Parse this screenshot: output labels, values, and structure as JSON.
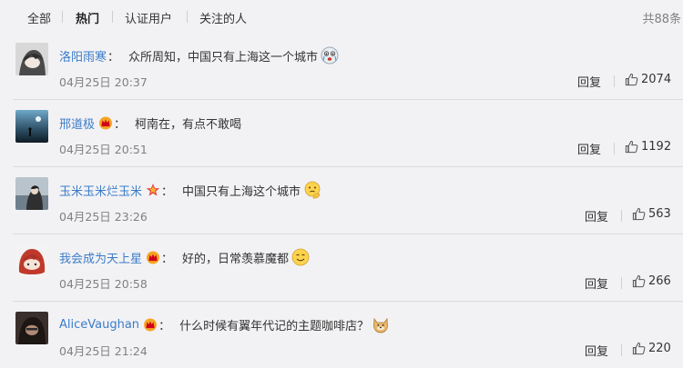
{
  "filter": {
    "tabs": [
      {
        "label": "全部"
      },
      {
        "label": "热门"
      },
      {
        "label": "认证用户"
      },
      {
        "label": "关注的人"
      }
    ],
    "total": "共88条"
  },
  "comments": [
    {
      "user": "洛阳雨寒",
      "user_color": "#3b7cc7",
      "badge": "",
      "text": "众所周知，中国只有上海这一个城市",
      "emoji": "crying-emoji-icon",
      "time": "04月25日 20:37",
      "reply_label": "回复",
      "likes": "2074"
    },
    {
      "user": "邢道极",
      "user_color": "#3b7cc7",
      "badge": "crown-badge-icon",
      "text": "柯南在，有点不敢喝",
      "emoji": "",
      "time": "04月25日 20:51",
      "reply_label": "回复",
      "likes": "1192"
    },
    {
      "user": "玉米玉米烂玉米",
      "user_color": "#3b7cc7",
      "badge": "star-badge-icon",
      "text": "中国只有上海这个城市",
      "emoji": "thinking-emoji-icon",
      "time": "04月25日 23:26",
      "reply_label": "回复",
      "likes": "563"
    },
    {
      "user": "我会成为天上星",
      "user_color": "#3b7cc7",
      "badge": "crown-badge-icon",
      "text": "好的，日常羡慕魔都",
      "emoji": "smile-emoji-icon",
      "time": "04月25日 20:58",
      "reply_label": "回复",
      "likes": "266"
    },
    {
      "user": "AliceVaughan",
      "user_color": "#3b7cc7",
      "badge": "crown-badge-icon",
      "text": "什么时候有翼年代记的主题咖啡店？",
      "emoji": "doge-emoji-icon",
      "time": "04月25日 21:24",
      "reply_label": "回复",
      "likes": "220"
    }
  ]
}
